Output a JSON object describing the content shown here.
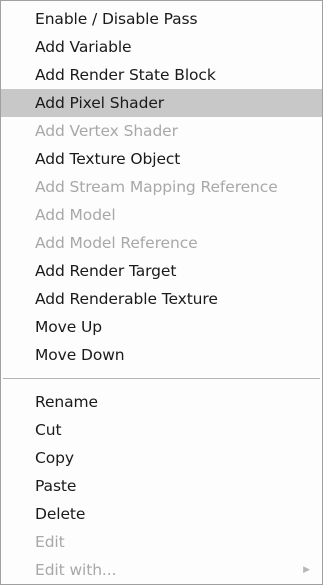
{
  "menu": {
    "group1": [
      {
        "label": "Enable / Disable Pass"
      },
      {
        "label": "Add Variable"
      },
      {
        "label": "Add Render State Block"
      },
      {
        "label": "Add Pixel Shader"
      },
      {
        "label": "Add Vertex Shader"
      },
      {
        "label": "Add Texture Object"
      },
      {
        "label": "Add Stream Mapping Reference"
      },
      {
        "label": "Add Model"
      },
      {
        "label": "Add Model Reference"
      },
      {
        "label": "Add Render Target"
      },
      {
        "label": "Add Renderable Texture"
      },
      {
        "label": "Move Up"
      },
      {
        "label": "Move Down"
      }
    ],
    "group2": [
      {
        "label": "Rename"
      },
      {
        "label": "Cut"
      },
      {
        "label": "Copy"
      },
      {
        "label": "Paste"
      },
      {
        "label": "Delete"
      },
      {
        "label": "Edit"
      },
      {
        "label": "Edit with..."
      }
    ],
    "submenu_arrow_glyph": "▶",
    "colors": {
      "highlight": "#c8c8c8",
      "enabled_text": "#1a1a1a",
      "disabled_text": "#a8a8a8",
      "border": "#a0a0a0"
    }
  }
}
